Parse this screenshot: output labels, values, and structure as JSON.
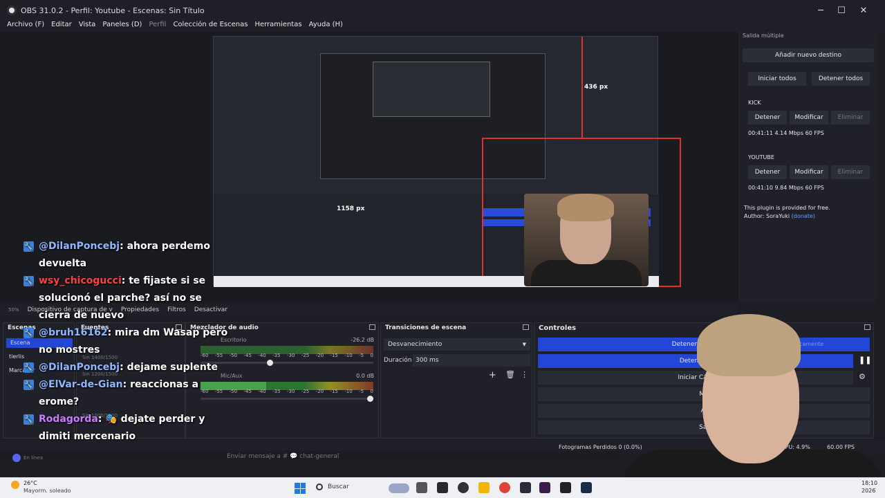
{
  "window": {
    "title": "OBS 31.0.2 - Perfil: Youtube - Escenas: Sin Título",
    "minimize": "─",
    "maximize": "☐",
    "close": "✕"
  },
  "menu": [
    "Archivo (F)",
    "Editar",
    "Vista",
    "Paneles (D)",
    "Perfil",
    "Colección de Escenas",
    "Herramientas",
    "Ayuda (H)"
  ],
  "nested": {
    "px_label_1": "1158 px",
    "px_label_2": "436 px"
  },
  "chat": [
    {
      "user": "@DilanPoncebj",
      "text": ": ahora perdemo devuelta",
      "color": "blue"
    },
    {
      "user": "wsy_chicogucci",
      "text": ": te fijaste si se solucionó el parche? así no se cierra de nuevo",
      "color": "red"
    },
    {
      "user": "@bruh16162",
      "text": ": mira dm Wasap pero no mostres",
      "color": "blue"
    },
    {
      "user": "@DilanPoncebj",
      "text": ": dejame suplente",
      "color": "blue"
    },
    {
      "user": "@ElVar-de-Gian",
      "text": ": reaccionas a erome?",
      "color": "blue"
    },
    {
      "user": "Rodagorda",
      "text": ": 🎭 dejate perder y dimiti mercenario",
      "color": "purple"
    }
  ],
  "multi_output": {
    "title": "Salida múltiple",
    "add_destination": "Añadir nuevo destino",
    "start_all": "Iniciar todos",
    "stop_all": "Detener todos",
    "targets": [
      {
        "name": "KICK",
        "stop": "Detener",
        "modify": "Modificar",
        "delete": "Eliminar",
        "stats": "00:41:11  4.14 Mbps  60 FPS"
      },
      {
        "name": "YOUTUBE",
        "stop": "Detener",
        "modify": "Modificar",
        "delete": "Eliminar",
        "stats": "00:41:10  9.84 Mbps  60 FPS"
      }
    ],
    "note": "This plugin is provided for free.",
    "author": "Author: SoraYuki",
    "author_link": "(donate)"
  },
  "source_toolbar": {
    "zoom": "50%",
    "source": "Dispositivo de captura de v",
    "properties": "Propiedades",
    "filters": "Filtros",
    "deactivate": "Desactivar"
  },
  "docks": {
    "scenes": "Escenas",
    "scene_items": [
      "Escena",
      "tierlis",
      "Marcador"
    ],
    "sources": "Fuentes",
    "source_sizes": [
      "Sin 1400/1500",
      "Sin 1200/1500",
      "Sin 1000/1500"
    ],
    "mixer": "Mezclador de audio",
    "mixer_channels": [
      {
        "name": "Escritorio",
        "db": "-26.2 dB",
        "level": 0.6,
        "volume": 0.4
      },
      {
        "name": "Mic/Aux",
        "db": "0.0 dB",
        "level": 0.38,
        "volume": 1.0
      }
    ],
    "mixer_ticks": [
      "-60",
      "-55",
      "-50",
      "-45",
      "-40",
      "-35",
      "-30",
      "-25",
      "-20",
      "-15",
      "-10",
      "-5",
      "0"
    ],
    "transitions": "Transiciones de escena",
    "transition_type": "Desvanecimiento",
    "duration_label": "Duración",
    "duration_value": "300 ms",
    "controls": "Controles",
    "control_buttons": [
      "Detener Transmisión",
      "Detener G",
      "Iniciar Cám",
      "Mo",
      "Aj",
      "Sal"
    ],
    "auto_label": "máticamente"
  },
  "status": {
    "frames": "Fotogramas Perdidos 0 (0.0%)",
    "cpu": "CPU: 4.9%",
    "fps": "60.00 FPS"
  },
  "discord": {
    "placeholder": "Enviar mensaje a # 💬 chat-general",
    "online": "En línea"
  },
  "taskbar": {
    "temp": "26°C",
    "weather": "Mayorm. soleado",
    "search": "Buscar",
    "time": "18:10",
    "date": "2026"
  },
  "colors": {
    "accent_blue": "#2446d6",
    "live_red": "#e23030",
    "panel": "#1f2028"
  }
}
